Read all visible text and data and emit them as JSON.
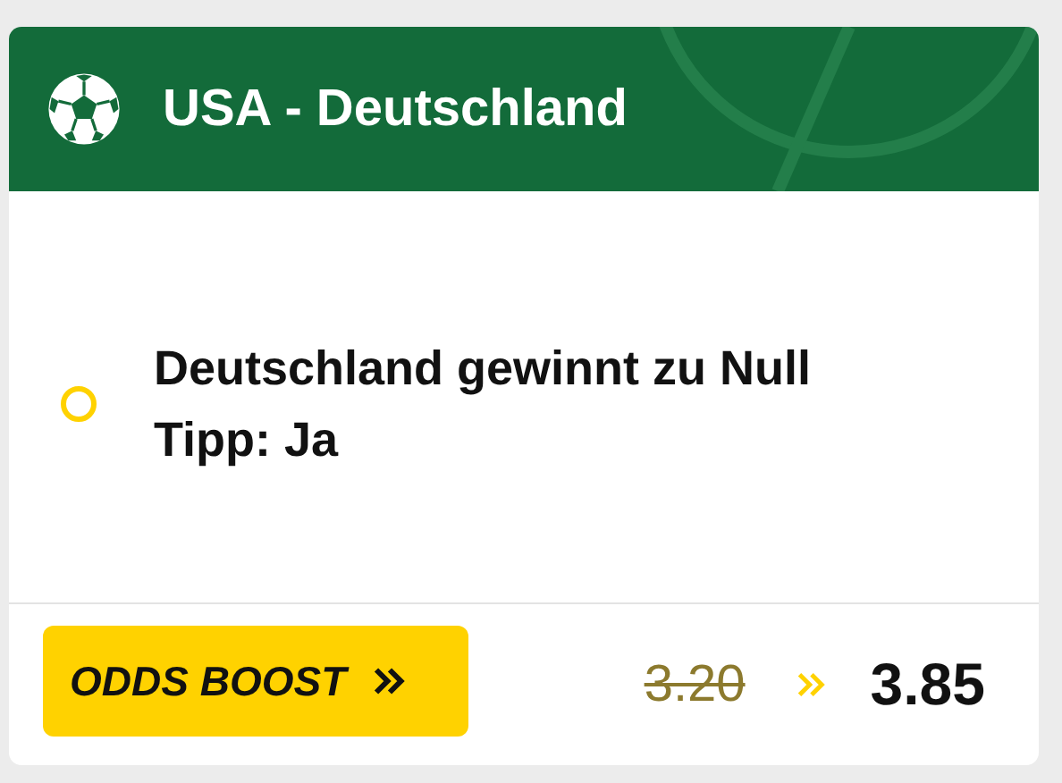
{
  "header": {
    "title": "USA - Deutschland"
  },
  "selection": {
    "selected": false,
    "lines": [
      "Deutschland gewinnt zu Null",
      "Tipp: Ja"
    ]
  },
  "footer": {
    "boost_button": {
      "label": "ODDS BOOST"
    },
    "old_odds": "3.20",
    "new_odds": "3.85"
  }
}
